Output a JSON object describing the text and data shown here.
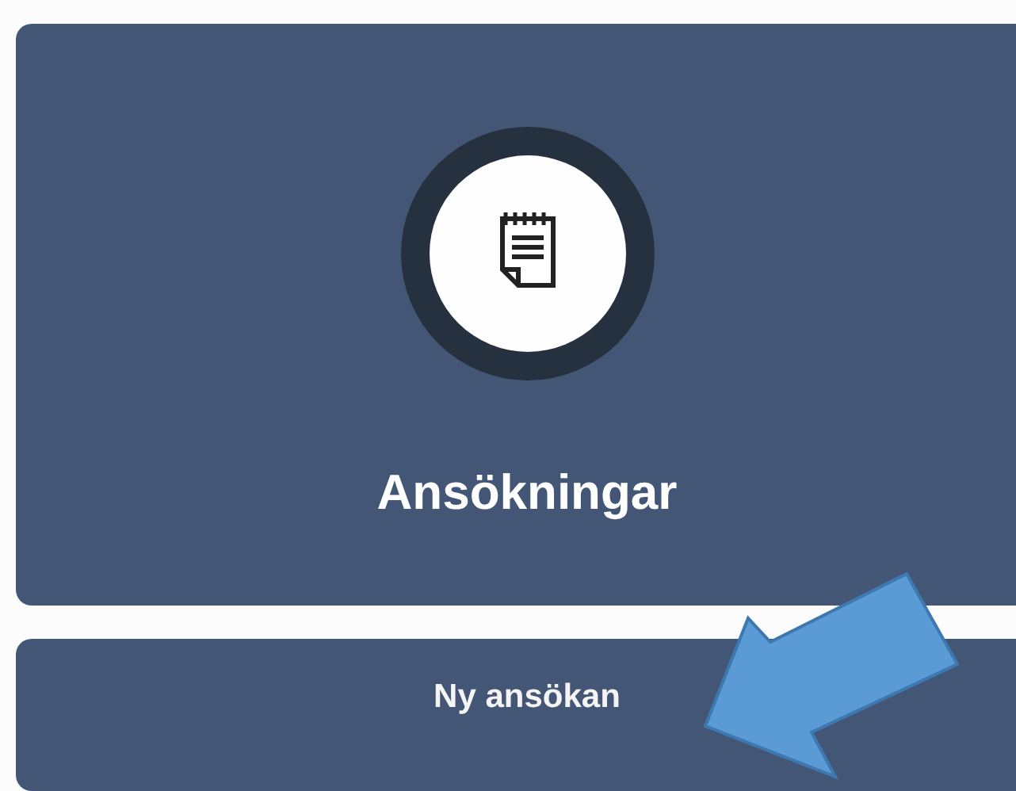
{
  "card": {
    "title": "Ansökningar"
  },
  "button": {
    "label": "Ny ansökan"
  }
}
